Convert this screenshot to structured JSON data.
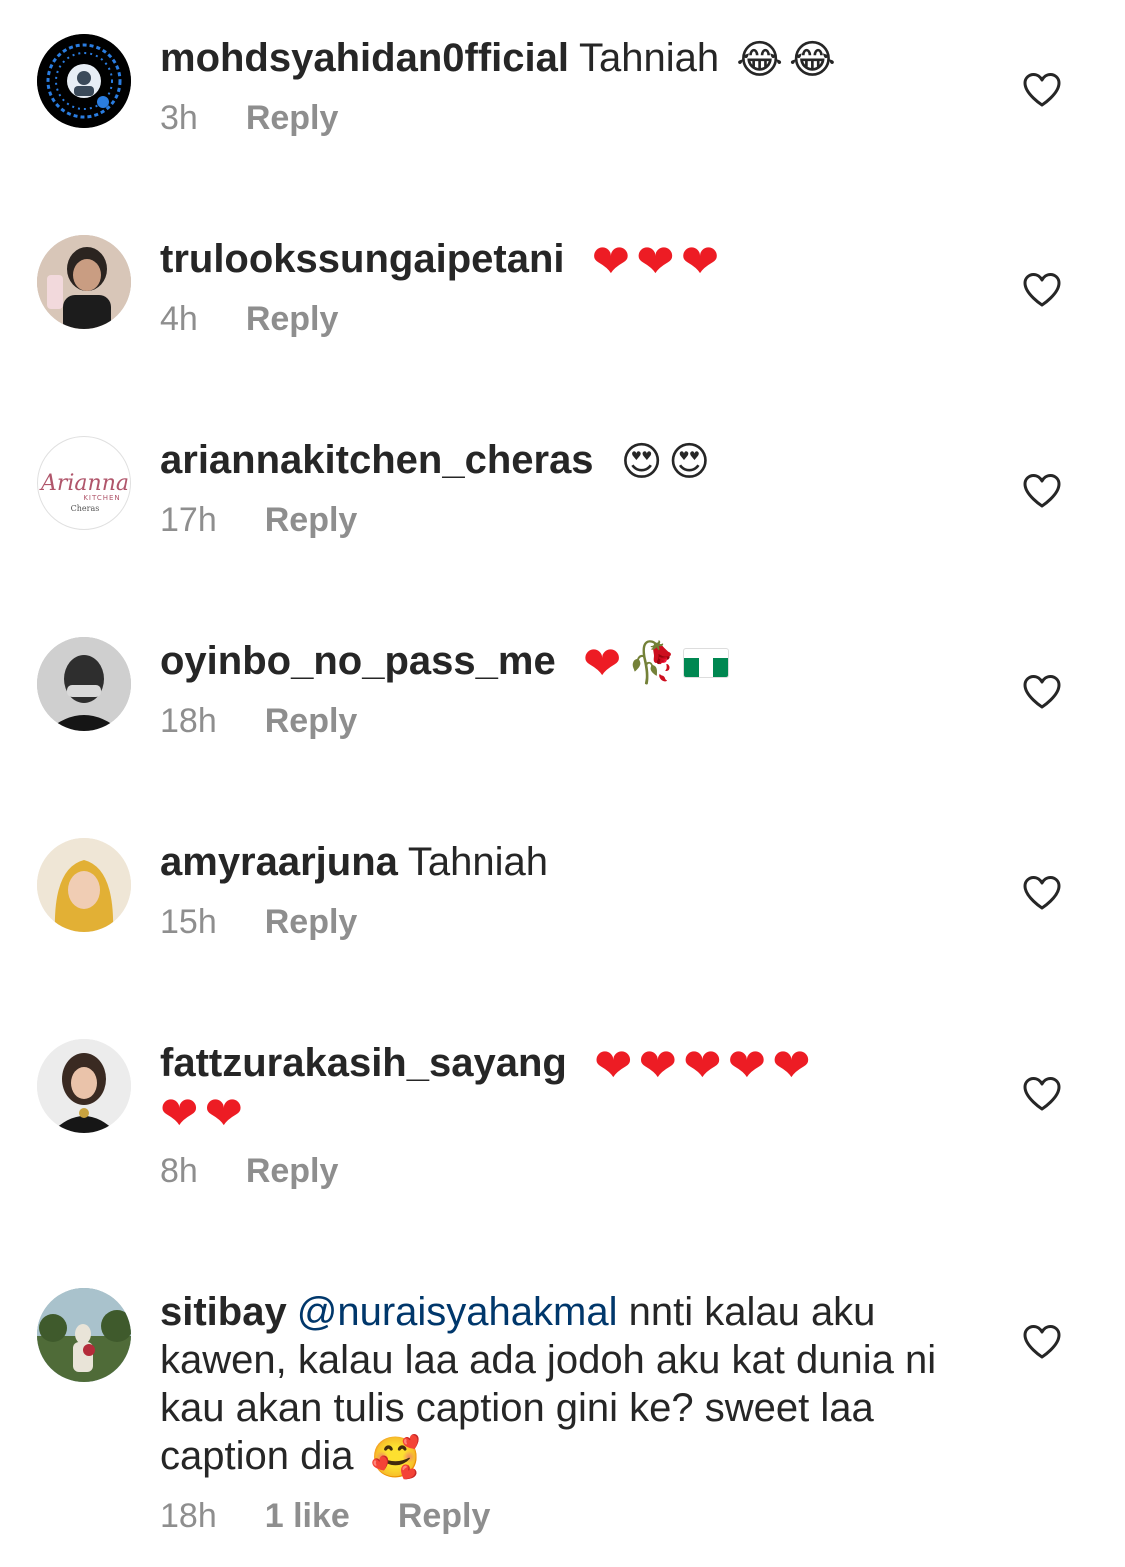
{
  "comments": [
    {
      "username": "mohdsyahidan0fficial",
      "text": "Tahniah",
      "emojis": [
        "😂",
        "😂"
      ],
      "time": "3h",
      "reply_label": "Reply"
    },
    {
      "username": "trulookssungaipetani",
      "text": "",
      "emojis": [
        "❤",
        "❤",
        "❤"
      ],
      "time": "4h",
      "reply_label": "Reply"
    },
    {
      "username": "ariannakitchen_cheras",
      "text": "",
      "emojis": [
        "😍",
        "😍"
      ],
      "time": "17h",
      "reply_label": "Reply",
      "avatar_logo": {
        "line1": "Arianna",
        "line2": "KITCHEN",
        "line3": "Cheras"
      }
    },
    {
      "username": "oyinbo_no_pass_me",
      "text": "",
      "emojis": [
        "❤",
        "🥀",
        "flag-ng"
      ],
      "time": "18h",
      "reply_label": "Reply"
    },
    {
      "username": "amyraarjuna",
      "text": "Tahniah",
      "emojis": [],
      "time": "15h",
      "reply_label": "Reply"
    },
    {
      "username": "fattzurakasih_sayang",
      "text": "",
      "emojis": [
        "❤",
        "❤",
        "❤",
        "❤",
        "❤",
        "❤",
        "❤"
      ],
      "time": "8h",
      "reply_label": "Reply"
    },
    {
      "username": "sitibay",
      "mention": "@nuraisyahakmal",
      "text": "nnti kalau aku kawen, kalau laa ada jodoh aku kat dunia ni kau akan tulis caption gini ke? sweet laa caption dia",
      "emojis": [
        "🥰"
      ],
      "time": "18h",
      "likes": "1 like",
      "reply_label": "Reply"
    }
  ],
  "icons": {
    "like": "heart-outline-icon"
  },
  "colors": {
    "text": "#262626",
    "meta": "#8e8e8e",
    "mention": "#00376b",
    "heart": "#ed1c24"
  }
}
